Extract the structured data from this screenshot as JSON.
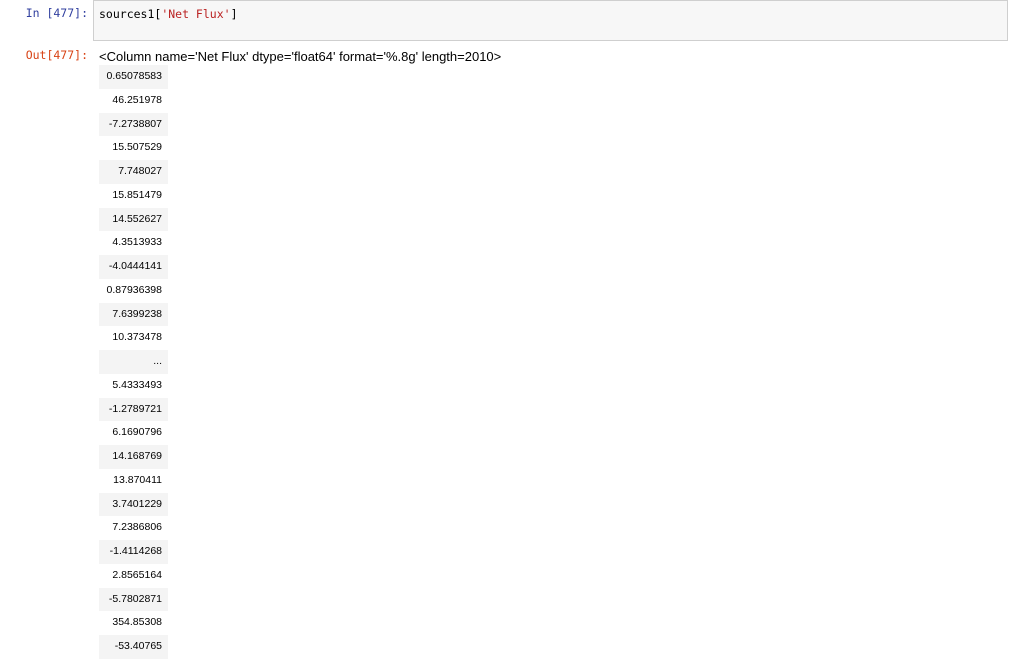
{
  "cell": {
    "in_prompt": "In [477]:",
    "out_prompt": "Out[477]:",
    "code_prefix": "sources1[",
    "code_string": "'Net Flux'",
    "code_suffix": "]",
    "output_header": "<Column name='Net Flux' dtype='float64' format='%.8g' length=2010>",
    "values": [
      "0.65078583",
      "46.251978",
      "-7.2738807",
      "15.507529",
      "7.748027",
      "15.851479",
      "14.552627",
      "4.3513933",
      "-4.0444141",
      "0.87936398",
      "7.6399238",
      "10.373478",
      "...",
      "5.4333493",
      "-1.2789721",
      "6.1690796",
      "14.168769",
      "13.870411",
      "3.7401229",
      "7.2386806",
      "-1.4114268",
      "2.8565164",
      "-5.7802871",
      "354.85308",
      "-53.40765"
    ]
  }
}
